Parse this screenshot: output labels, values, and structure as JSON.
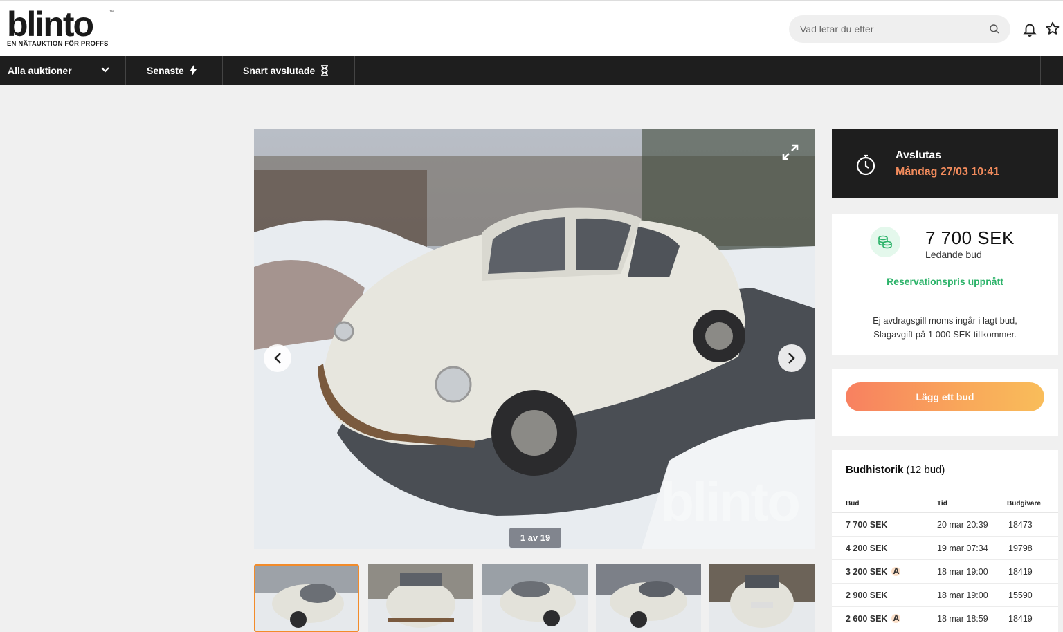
{
  "header": {
    "logo_word": "blinto",
    "logo_tm": "™",
    "logo_tagline": "EN NÄTAUKTION FÖR PROFFS",
    "search_placeholder": "Vad letar du efter",
    "icons": [
      "search-icon",
      "bell-icon",
      "star-icon"
    ]
  },
  "nav": {
    "all_auctions": "Alla auktioner",
    "latest": "Senaste",
    "ending_soon": "Snart avslutade"
  },
  "gallery": {
    "counter": "1 av 19",
    "watermark": "blinto",
    "thumbnail_count": 5,
    "active_thumbnail": 1
  },
  "ends": {
    "label": "Avslutas",
    "date": "Måndag 27/03 10:41"
  },
  "bid": {
    "amount": "7 700 SEK",
    "sub": "Ledande bud",
    "reserve": "Reservationspris uppnått",
    "vat_line1": "Ej avdragsgill moms ingår i lagt bud,",
    "vat_line2": "Slagavgift på 1 000 SEK tillkommer."
  },
  "place_bid": {
    "label": "Lägg ett bud"
  },
  "history": {
    "title": "Budhistorik",
    "count": "(12 bud)",
    "columns": [
      "Bud",
      "Tid",
      "Budgivare"
    ],
    "rows": [
      {
        "amount": "7 700 SEK",
        "auto": "",
        "time": "20 mar 20:39",
        "bidder": "18473"
      },
      {
        "amount": "4 200 SEK",
        "auto": "",
        "time": "19 mar 07:34",
        "bidder": "19798"
      },
      {
        "amount": "3 200 SEK",
        "auto": "A",
        "time": "18 mar 19:00",
        "bidder": "18419"
      },
      {
        "amount": "2 900 SEK",
        "auto": "",
        "time": "18 mar 19:00",
        "bidder": "15590"
      },
      {
        "amount": "2 600 SEK",
        "auto": "A",
        "time": "18 mar 18:59",
        "bidder": "18419"
      }
    ]
  },
  "colors": {
    "accent_orange": "#f28b2a",
    "nav_bg": "#1e1e1e",
    "reserve_green": "#2db36a",
    "date_orange": "#f28b5c"
  }
}
